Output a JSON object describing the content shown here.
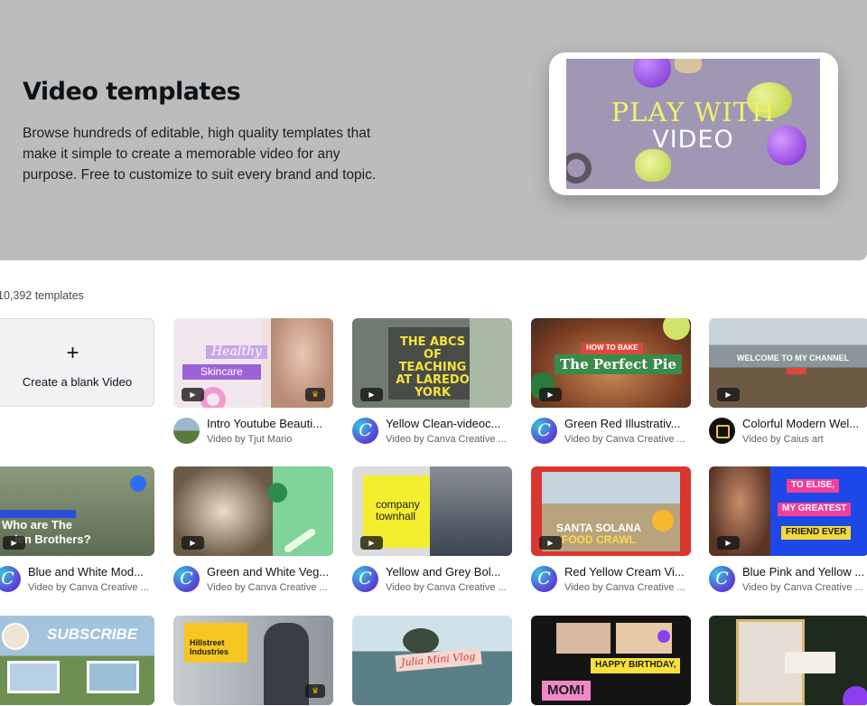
{
  "hero": {
    "title": "Video templates",
    "description": "Browse hundreds of editable, high quality templates that make it simple to create a memorable video for any purpose. Free to customize to suit every brand and topic.",
    "preview_line1": "PLAY WITH",
    "preview_line2": "VIDEO"
  },
  "count_label": "10,392 templates",
  "blank": {
    "plus": "+",
    "label": "Create a blank Video"
  },
  "icons": {
    "play": "▶",
    "crown": "♛",
    "canva": "C"
  },
  "templates": [
    {
      "title": "Intro Youtube Beauti...",
      "author": "Video by Tjut Mario",
      "thumb_text": [
        "Healthy",
        "Skincare"
      ]
    },
    {
      "title": "Yellow Clean-videoc...",
      "author": "Video by Canva Creative ...",
      "thumb_text": [
        "THE ABCS OF TEACHING AT LAREDO YORK"
      ]
    },
    {
      "title": "Green Red Illustrativ...",
      "author": "Video by Canva Creative ...",
      "thumb_text": [
        "HOW TO BAKE",
        "The Perfect Pie"
      ]
    },
    {
      "title": "Colorful Modern Wel...",
      "author": "Video by Caius art",
      "thumb_text": [
        "WELCOME TO MY CHANNEL"
      ]
    },
    {
      "title": "Blue and White Mod...",
      "author": "Video by Canva Creative ...",
      "thumb_text": [
        "Who are The",
        "len Brothers?"
      ]
    },
    {
      "title": "Green and White Veg...",
      "author": "Video by Canva Creative ...",
      "thumb_text": []
    },
    {
      "title": "Yellow and Grey Bol...",
      "author": "Video by Canva Creative ...",
      "thumb_text": [
        "company townhall"
      ]
    },
    {
      "title": "Red Yellow Cream Vi...",
      "author": "Video by Canva Creative ...",
      "thumb_text": [
        "SANTA SOLANA",
        "FOOD CRAWL"
      ]
    },
    {
      "title": "Blue Pink and Yellow ...",
      "author": "Video by Canva Creative ...",
      "thumb_text": [
        "TO ELISE,",
        "MY GREATEST",
        "FRIEND EVER"
      ]
    },
    {
      "title": "",
      "author": "",
      "thumb_text": [
        "SUBSCRIBE"
      ]
    },
    {
      "title": "",
      "author": "",
      "thumb_text": [
        "Hillstreet Industries"
      ]
    },
    {
      "title": "",
      "author": "",
      "thumb_text": [
        "Julia Mini Vlog"
      ]
    },
    {
      "title": "",
      "author": "",
      "thumb_text": [
        "HAPPY BIRTHDAY,",
        "MOM!"
      ]
    },
    {
      "title": "",
      "author": "",
      "thumb_text": []
    }
  ]
}
